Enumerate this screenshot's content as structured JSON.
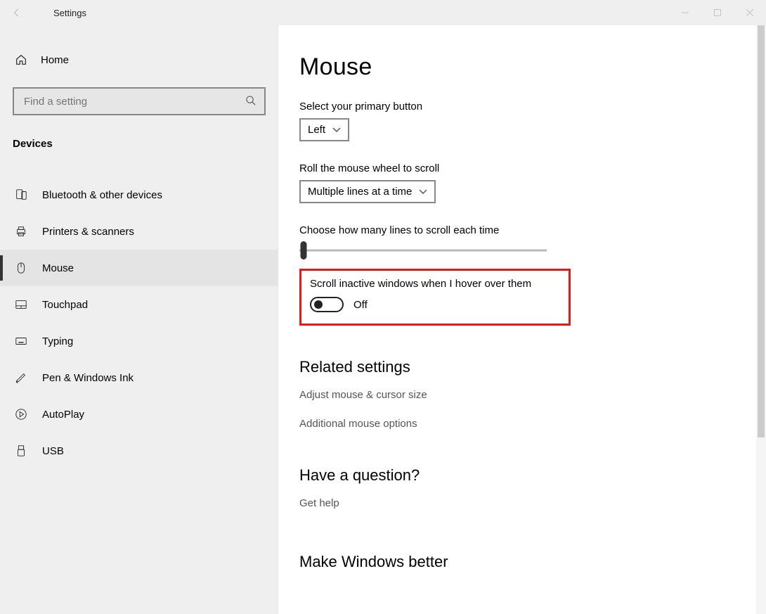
{
  "window": {
    "title": "Settings"
  },
  "sidebar": {
    "home": "Home",
    "search_placeholder": "Find a setting",
    "section": "Devices",
    "items": [
      {
        "label": "Bluetooth & other devices"
      },
      {
        "label": "Printers & scanners"
      },
      {
        "label": "Mouse"
      },
      {
        "label": "Touchpad"
      },
      {
        "label": "Typing"
      },
      {
        "label": "Pen & Windows Ink"
      },
      {
        "label": "AutoPlay"
      },
      {
        "label": "USB"
      }
    ]
  },
  "main": {
    "title": "Mouse",
    "primary": {
      "label": "Select your primary button",
      "value": "Left"
    },
    "wheel": {
      "label": "Roll the mouse wheel to scroll",
      "value": "Multiple lines at a time"
    },
    "lines": {
      "label": "Choose how many lines to scroll each time"
    },
    "inactive": {
      "label": "Scroll inactive windows when I hover over them",
      "state": "Off"
    },
    "related": {
      "heading": "Related settings",
      "links": [
        "Adjust mouse & cursor size",
        "Additional mouse options"
      ]
    },
    "question": {
      "heading": "Have a question?",
      "link": "Get help"
    },
    "feedback": {
      "heading": "Make Windows better"
    }
  }
}
